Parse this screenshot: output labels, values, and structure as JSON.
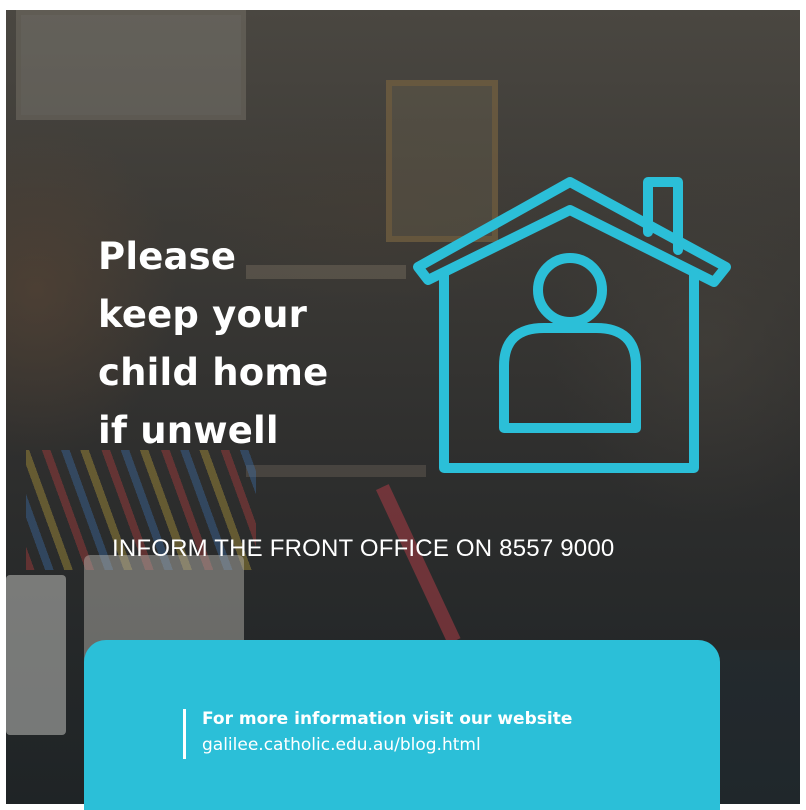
{
  "headline": {
    "lines": [
      "Please",
      "keep your",
      "child home",
      "if unwell"
    ]
  },
  "contact": {
    "text": "INFORM THE FRONT OFFICE ON 8557 9000"
  },
  "info_panel": {
    "title": "For more information visit our website",
    "url": "galilee.catholic.edu.au/blog.html"
  },
  "graphic": {
    "icon": "house-with-person-icon"
  },
  "colors": {
    "accent": "#2bbfd8",
    "text": "#ffffff",
    "overlay": "#2f2f2e"
  }
}
